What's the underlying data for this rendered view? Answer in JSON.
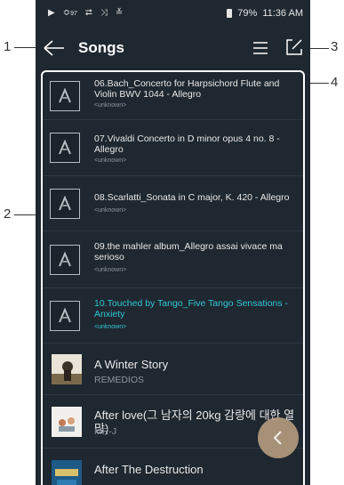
{
  "status": {
    "left_icons": [
      "play-icon",
      "wifi-icon",
      "repeat-icon",
      "shuffle-icon",
      "equalizer-icon"
    ],
    "wifi_label": "97",
    "battery": "79%",
    "time": "11:36 AM"
  },
  "header": {
    "title": "Songs"
  },
  "songs": [
    {
      "title": "06.Bach_Concerto for Harpsichord Flute and Violin BWV 1044 - Allegro",
      "artist": "<unknown>",
      "art": "logo",
      "active": false
    },
    {
      "title": "07.Vivaldi Concerto in D minor opus 4 no. 8 - Allegro",
      "artist": "<unknown>",
      "art": "logo",
      "active": false
    },
    {
      "title": "08.Scarlatti_Sonata in C major, K. 420 - Allegro",
      "artist": "<unknown>",
      "art": "logo",
      "active": false
    },
    {
      "title": "09.the mahler album_Allegro assai vivace ma serioso",
      "artist": "<unknown>",
      "art": "logo",
      "active": false
    },
    {
      "title": "10.Touched by Tango_Five Tango Sensations - Anxiety",
      "artist": "<unknown>",
      "art": "logo",
      "active": true
    },
    {
      "title": "A Winter Story",
      "artist": "REMEDIOS",
      "art": "photo",
      "active": false
    },
    {
      "title": "After love(그 남자의 20kg 감량에 대한 열망)",
      "artist": "MR-J",
      "art": "photo",
      "active": false
    },
    {
      "title": "After The Destruction",
      "artist": "",
      "art": "photo",
      "active": false
    }
  ],
  "callouts": [
    "1",
    "2",
    "3",
    "4"
  ],
  "colors": {
    "background": "#1f2730",
    "active": "#2fc8d3",
    "fab": "#b29a7e"
  }
}
